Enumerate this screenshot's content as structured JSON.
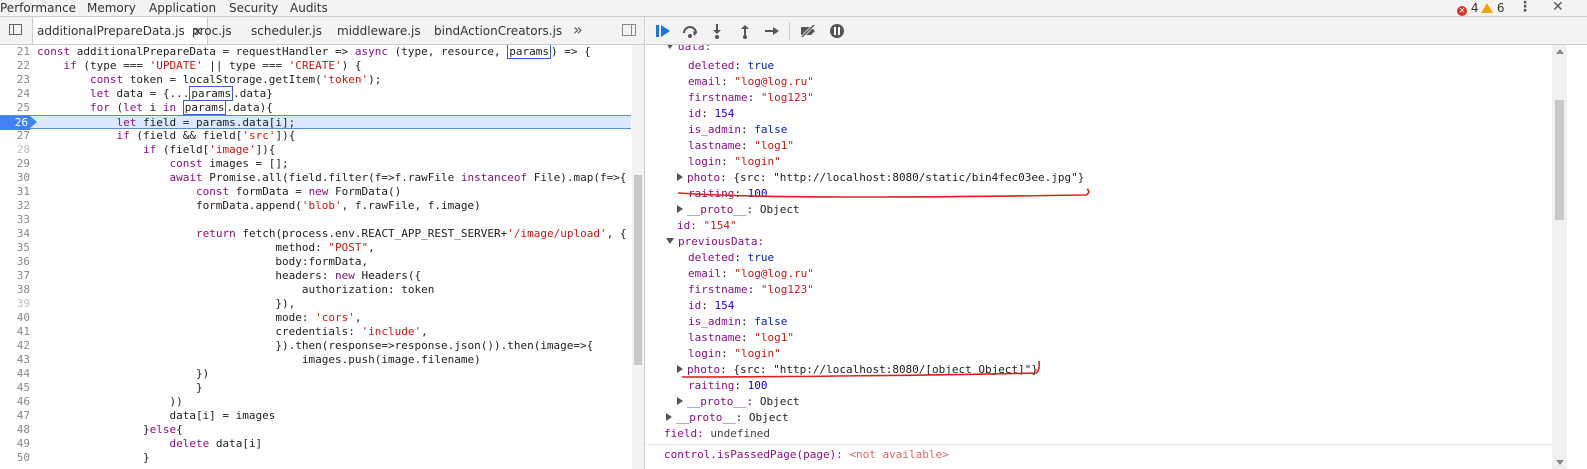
{
  "devtools": {
    "tabs": [
      "Performance",
      "Memory",
      "Application",
      "Security",
      "Audits"
    ],
    "errors": "4",
    "warnings": "6"
  },
  "sources": {
    "file_tabs": [
      "additionalPrepareData.js",
      "proc.js",
      "scheduler.js",
      "middleware.js",
      "bindActionCreators.js"
    ],
    "more": "»",
    "close_tab": "×"
  },
  "code_lines": [
    {
      "n": "21",
      "t": "const additionalPrepareData = requestHandler => async (type, resource, params) => {"
    },
    {
      "n": "22",
      "t": "    if (type === 'UPDATE' || type === 'CREATE') {"
    },
    {
      "n": "23",
      "t": "        const token = localStorage.getItem('token');"
    },
    {
      "n": "24",
      "t": "        let data = {...params.data}"
    },
    {
      "n": "25",
      "t": "        for (let i in params.data){"
    },
    {
      "n": "26",
      "t": "            let field = params.data[i];"
    },
    {
      "n": "27",
      "t": "            if (field && field['src']){"
    },
    {
      "n": "28",
      "t": "                if (field['image']){"
    },
    {
      "n": "29",
      "t": "                    const images = [];"
    },
    {
      "n": "30",
      "t": "                    await Promise.all(field.filter(f=>f.rawFile instanceof File).map(f=>{"
    },
    {
      "n": "31",
      "t": "                        const formData = new FormData()"
    },
    {
      "n": "32",
      "t": "                        formData.append('blob', f.rawFile, f.image)"
    },
    {
      "n": "33",
      "t": ""
    },
    {
      "n": "34",
      "t": "                        return fetch(process.env.REACT_APP_REST_SERVER+'/image/upload', {"
    },
    {
      "n": "35",
      "t": "                                    method: \"POST\","
    },
    {
      "n": "36",
      "t": "                                    body:formData,"
    },
    {
      "n": "37",
      "t": "                                    headers: new Headers({"
    },
    {
      "n": "38",
      "t": "                                        authorization: token"
    },
    {
      "n": "39",
      "t": "                                    }),"
    },
    {
      "n": "40",
      "t": "                                    mode: 'cors',"
    },
    {
      "n": "41",
      "t": "                                    credentials: 'include',"
    },
    {
      "n": "42",
      "t": "                                    }).then(response=>response.json()).then(image=>{"
    },
    {
      "n": "43",
      "t": "                                        images.push(image.filename)"
    },
    {
      "n": "44",
      "t": "                        })"
    },
    {
      "n": "45",
      "t": "                        }"
    },
    {
      "n": "46",
      "t": "                    ))"
    },
    {
      "n": "47",
      "t": "                    data[i] = images"
    },
    {
      "n": "48",
      "t": "                }else{"
    },
    {
      "n": "49",
      "t": "                    delete data[i]"
    },
    {
      "n": "50",
      "t": "                }"
    }
  ],
  "current_line": "26",
  "scope": {
    "data_label": "data:",
    "data": {
      "deleted": "true",
      "email": "\"log@log.ru\"",
      "firstname": "\"log123\"",
      "id": "154",
      "is_admin": "false",
      "lastname": "\"log1\"",
      "login": "\"login\"",
      "photo": "{src: \"http://localhost:8080/static/bin4fec03ee.jpg\"}",
      "raiting": "100",
      "proto": "Object"
    },
    "id_label": "id:",
    "id_value": "\"154\"",
    "previous_label": "previousData:",
    "previous": {
      "deleted": "true",
      "email": "\"log@log.ru\"",
      "firstname": "\"log123\"",
      "id": "154",
      "is_admin": "false",
      "lastname": "\"log1\"",
      "login": "\"login\"",
      "photo": "{src: \"http://localhost:8080/[object Object]\"}",
      "raiting": "100",
      "proto": "Object"
    },
    "outer_proto": "Object",
    "field_label": "field:",
    "field_value": "undefined",
    "watch_expr": "control.isPassedPage(page):",
    "watch_value": "<not available>"
  },
  "colors": {
    "annotation": "#e02020",
    "exec_line": "#4281f4"
  }
}
